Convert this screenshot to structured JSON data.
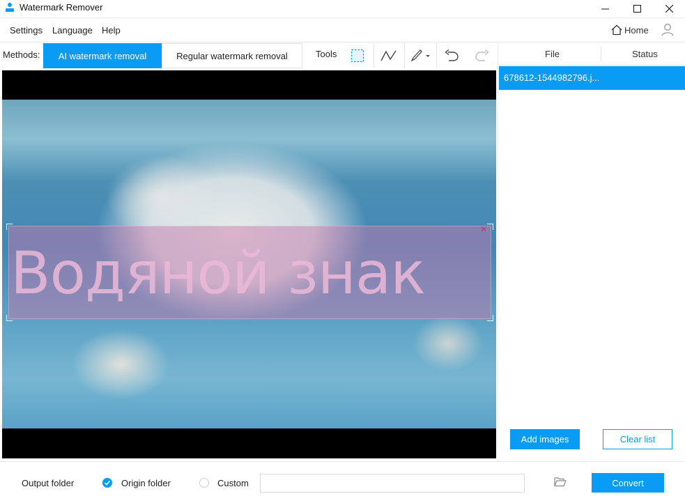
{
  "app": {
    "title": "Watermark Remover"
  },
  "menu": {
    "settings": "Settings",
    "language": "Language",
    "help": "Help",
    "home": "Home"
  },
  "methods": {
    "label": "Methods:",
    "ai": "AI watermark removal",
    "regular": "Regular watermark removal",
    "tools_label": "Tools"
  },
  "filelist": {
    "col_file": "File",
    "col_status": "Status",
    "files": [
      {
        "name": "678612-1544982796.j...",
        "status": ""
      }
    ]
  },
  "buttons": {
    "add_images": "Add images",
    "clear_list": "Clear list",
    "convert": "Convert"
  },
  "canvas": {
    "watermark_text": "Водяной знак"
  },
  "output": {
    "label": "Output folder",
    "origin": "Origin folder",
    "custom": "Custom",
    "custom_path": ""
  },
  "colors": {
    "accent": "#0a9bf5"
  },
  "icons": {
    "app": "app-icon",
    "minimize": "minimize-icon",
    "maximize": "maximize-icon",
    "close": "close-icon",
    "home": "home-icon",
    "user": "user-icon",
    "rect_select": "rect-select-icon",
    "polyline": "polyline-icon",
    "brush": "brush-icon",
    "undo": "undo-icon",
    "redo": "redo-icon",
    "folder": "folder-open-icon"
  }
}
